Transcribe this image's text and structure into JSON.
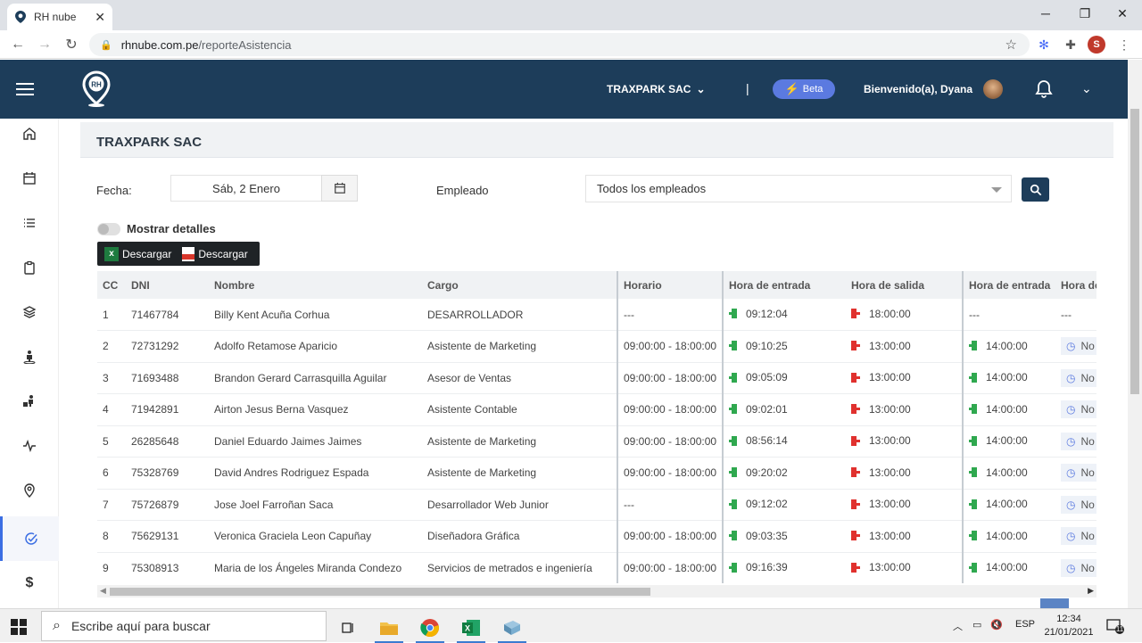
{
  "browser": {
    "tab_title": "RH nube",
    "url_host": "rhnube.com.pe",
    "url_path": "/reporteAsistencia",
    "profile_initial": "S"
  },
  "header": {
    "company": "TRAXPARK SAC",
    "separator": "|",
    "beta_label": "Beta",
    "welcome": "Bienvenido(a), Dyana"
  },
  "sidebar": {
    "items": [
      {
        "name": "home-icon"
      },
      {
        "name": "calendar-icon"
      },
      {
        "name": "list-icon"
      },
      {
        "name": "clipboard-icon"
      },
      {
        "name": "layers-icon"
      },
      {
        "name": "person-location-icon"
      },
      {
        "name": "person-moving-icon"
      },
      {
        "name": "activity-icon"
      },
      {
        "name": "map-pin-icon"
      },
      {
        "name": "check-circle-icon",
        "active": true
      },
      {
        "name": "dollar-icon"
      }
    ]
  },
  "panel": {
    "title": "TRAXPARK SAC"
  },
  "filters": {
    "fecha_label": "Fecha:",
    "fecha_value": "Sáb, 2 Enero",
    "empleado_label": "Empleado",
    "empleado_value": "Todos los empleados",
    "toggle_label": "Mostrar detalles",
    "download_excel": "Descargar",
    "download_pdf": "Descargar"
  },
  "table": {
    "headers": [
      "CC",
      "DNI",
      "Nombre",
      "Cargo",
      "Horario",
      "Hora de entrada",
      "Hora de salida",
      "Hora de entrada",
      "Hora de"
    ],
    "rows": [
      {
        "cc": "1",
        "dni": "71467784",
        "nombre": "Billy Kent Acuña Corhua",
        "cargo": "DESARROLLADOR",
        "horario": "---",
        "entrada1": "09:12:04",
        "salida1": "18:00:00",
        "entrada2": "---",
        "extra": "---"
      },
      {
        "cc": "2",
        "dni": "72731292",
        "nombre": "Adolfo Retamose Aparicio",
        "cargo": "Asistente de Marketing",
        "horario": "09:00:00 - 18:00:00",
        "entrada1": "09:10:25",
        "salida1": "13:00:00",
        "entrada2": "14:00:00",
        "extra": "No"
      },
      {
        "cc": "3",
        "dni": "71693488",
        "nombre": "Brandon Gerard Carrasquilla Aguilar",
        "cargo": "Asesor de Ventas",
        "horario": "09:00:00 - 18:00:00",
        "entrada1": "09:05:09",
        "salida1": "13:00:00",
        "entrada2": "14:00:00",
        "extra": "No"
      },
      {
        "cc": "4",
        "dni": "71942891",
        "nombre": "Airton Jesus Berna Vasquez",
        "cargo": "Asistente Contable",
        "horario": "09:00:00 - 18:00:00",
        "entrada1": "09:02:01",
        "salida1": "13:00:00",
        "entrada2": "14:00:00",
        "extra": "No"
      },
      {
        "cc": "5",
        "dni": "26285648",
        "nombre": "Daniel Eduardo Jaimes Jaimes",
        "cargo": "Asistente de Marketing",
        "horario": "09:00:00 - 18:00:00",
        "entrada1": "08:56:14",
        "salida1": "13:00:00",
        "entrada2": "14:00:00",
        "extra": "No"
      },
      {
        "cc": "6",
        "dni": "75328769",
        "nombre": "David Andres Rodriguez Espada",
        "cargo": "Asistente de Marketing",
        "horario": "09:00:00 - 18:00:00",
        "entrada1": "09:20:02",
        "salida1": "13:00:00",
        "entrada2": "14:00:00",
        "extra": "No"
      },
      {
        "cc": "7",
        "dni": "75726879",
        "nombre": "Jose Joel Farroñan Saca",
        "cargo": "Desarrollador Web Junior",
        "horario": "---",
        "entrada1": "09:12:02",
        "salida1": "13:00:00",
        "entrada2": "14:00:00",
        "extra": "No"
      },
      {
        "cc": "8",
        "dni": "75629131",
        "nombre": "Veronica Graciela Leon Capuñay",
        "cargo": "Diseñadora Gráfica",
        "horario": "09:00:00 - 18:00:00",
        "entrada1": "09:03:35",
        "salida1": "13:00:00",
        "entrada2": "14:00:00",
        "extra": "No"
      },
      {
        "cc": "9",
        "dni": "75308913",
        "nombre": "Maria de los Ángeles Miranda Condezo",
        "cargo": "Servicios de metrados e ingeniería",
        "horario": "09:00:00 - 18:00:00",
        "entrada1": "09:16:39",
        "salida1": "13:00:00",
        "entrada2": "14:00:00",
        "extra": "No"
      }
    ]
  },
  "taskbar": {
    "search_placeholder": "Escribe aquí para buscar",
    "lang": "ESP",
    "time": "12:34",
    "date": "21/01/2021",
    "notif_count": "11"
  },
  "colors": {
    "header_bg": "#1d3d5a",
    "accent": "#3b6ee3",
    "beta_bg": "#5b7ae0",
    "entry_green": "#2fa84f",
    "exit_red": "#e0312e"
  }
}
